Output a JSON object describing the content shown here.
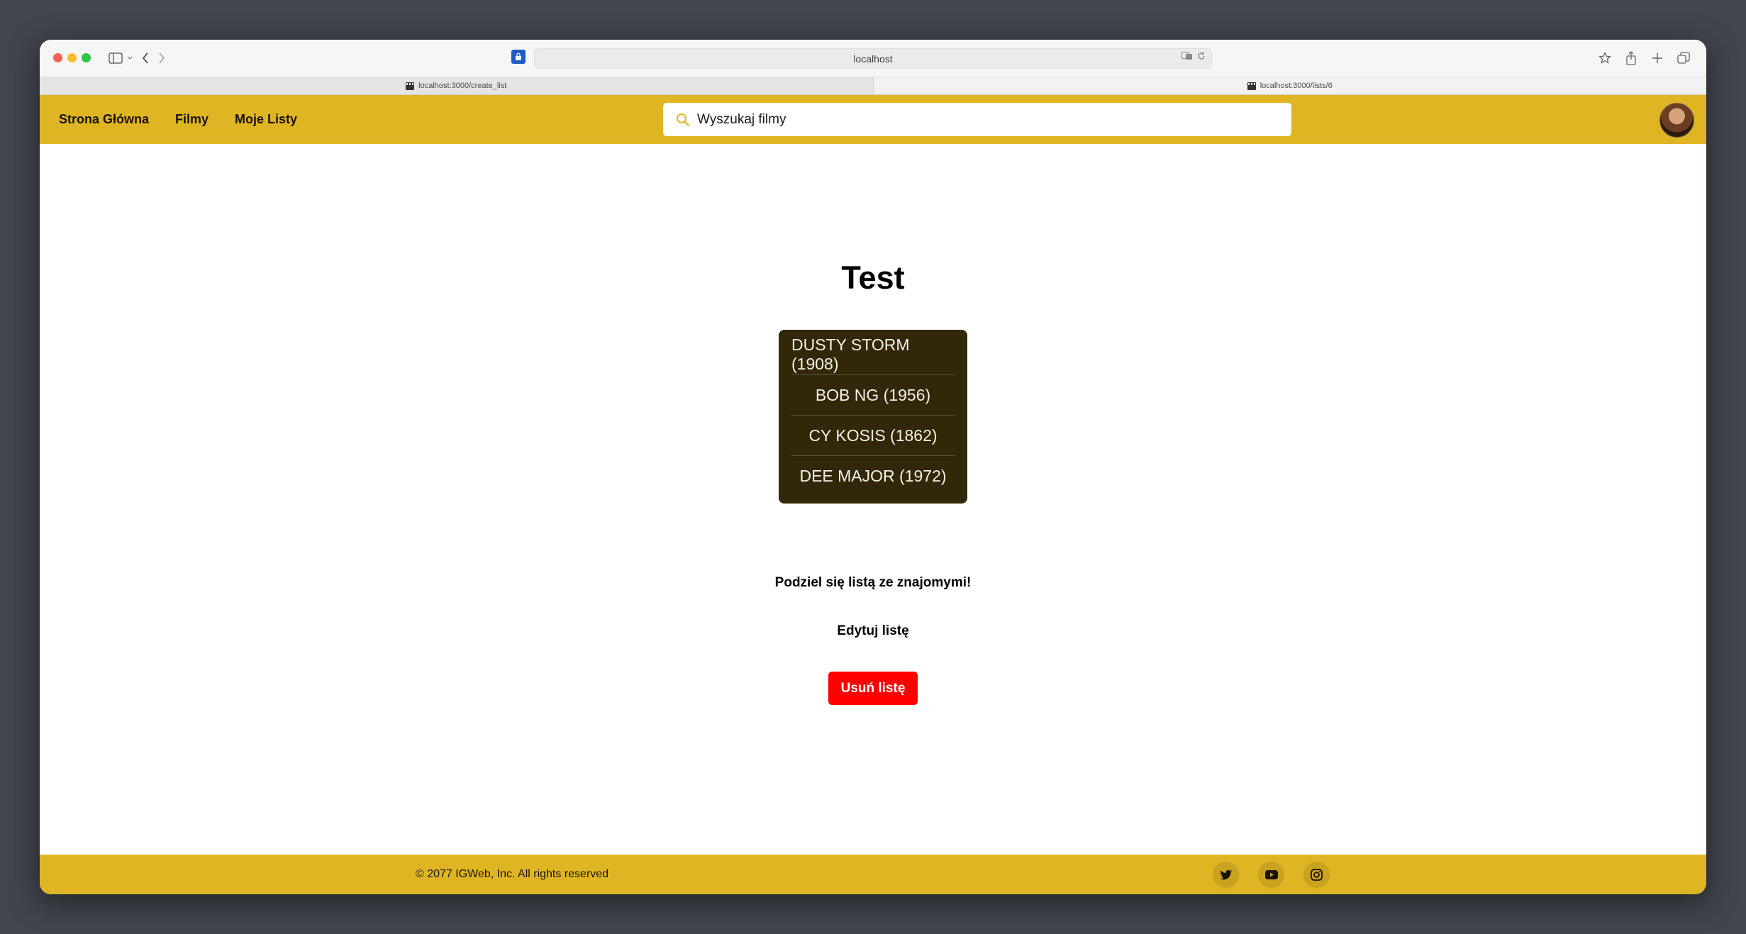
{
  "browser": {
    "address": "localhost",
    "tabs": [
      {
        "label": "localhost:3000/create_list"
      },
      {
        "label": "localhost:3000/lists/6"
      }
    ]
  },
  "header": {
    "nav": [
      {
        "label": "Strona Główna"
      },
      {
        "label": "Filmy"
      },
      {
        "label": "Moje Listy"
      }
    ],
    "search_placeholder": "Wyszukaj filmy"
  },
  "list": {
    "title": "Test",
    "movies": [
      {
        "label": "DUSTY STORM (1908)"
      },
      {
        "label": "BOB NG (1956)"
      },
      {
        "label": "CY KOSIS (1862)"
      },
      {
        "label": "DEE MAJOR (1972)"
      }
    ],
    "share_label": "Podziel się listą ze znajomymi!",
    "edit_label": "Edytuj listę",
    "delete_label": "Usuń listę"
  },
  "footer": {
    "copyright": "© 2077 IGWeb, Inc. All rights reserved",
    "socials": [
      "twitter-icon",
      "youtube-icon",
      "instagram-icon"
    ]
  },
  "colors": {
    "accent": "#dfb524",
    "list_bg": "#322709",
    "delete": "#fe0000"
  }
}
